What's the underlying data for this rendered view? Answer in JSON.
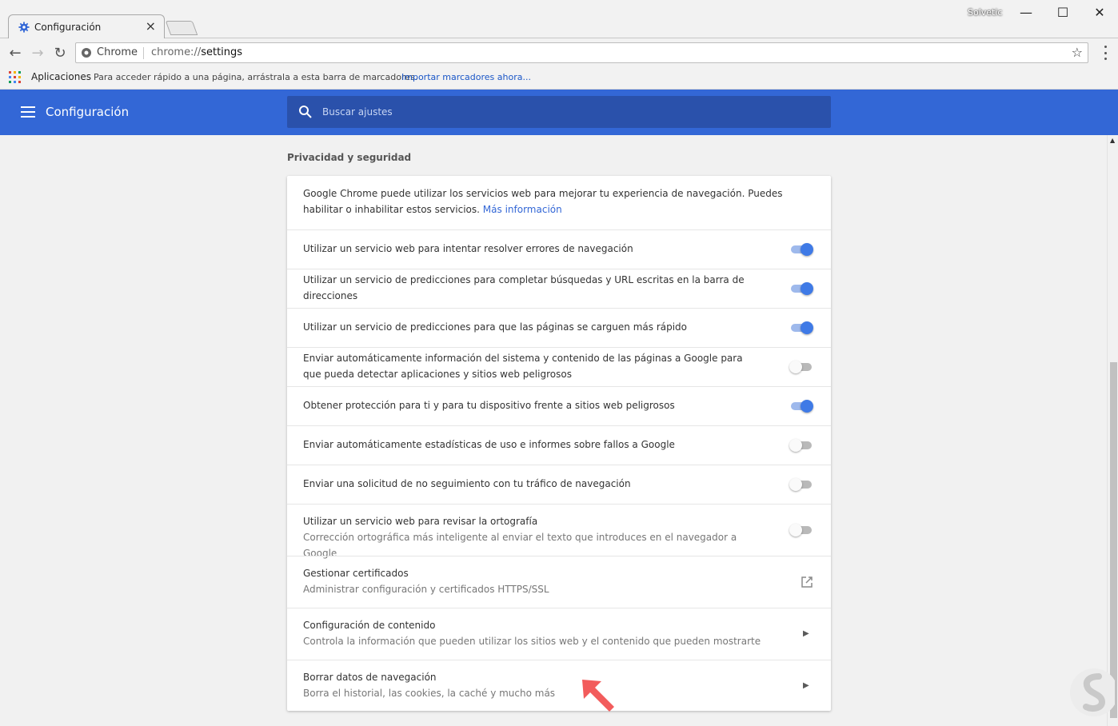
{
  "window": {
    "tab_title": "Configuración",
    "tab_close": "×",
    "user_label": "Solvetic",
    "minimize": "—",
    "maximize": "☐",
    "close": "✕"
  },
  "toolbar": {
    "back": "←",
    "forward": "→",
    "reload": "↻",
    "chip": "Chrome",
    "url_scheme": "chrome://",
    "url_path": "settings",
    "star": "☆"
  },
  "bookmarks": {
    "apps_label": "Aplicaciones",
    "hint": "Para acceder rápido a una página, arrástrala a esta barra de marcadores.",
    "import_link": "Importar marcadores ahora..."
  },
  "header": {
    "title": "Configuración",
    "search_placeholder": "Buscar ajustes"
  },
  "section": {
    "title": "Privacidad y seguridad",
    "intro_text": "Google Chrome puede utilizar los servicios web para mejorar tu experiencia de navegación. Puedes habilitar o inhabilitar estos servicios.",
    "intro_link": "Más información",
    "settings": [
      {
        "label": "Utilizar un servicio web para intentar resolver errores de navegación",
        "enabled": true
      },
      {
        "label": "Utilizar un servicio de predicciones para completar búsquedas y URL escritas en la barra de direcciones",
        "enabled": true
      },
      {
        "label": "Utilizar un servicio de predicciones para que las páginas se carguen más rápido",
        "enabled": true
      },
      {
        "label": "Enviar automáticamente información del sistema y contenido de las páginas a Google para que pueda detectar aplicaciones y sitios web peligrosos",
        "enabled": false
      },
      {
        "label": "Obtener protección para ti y para tu dispositivo frente a sitios web peligrosos",
        "enabled": true
      },
      {
        "label": "Enviar automáticamente estadísticas de uso e informes sobre fallos a Google",
        "enabled": false
      },
      {
        "label": "Enviar una solicitud de no seguimiento con tu tráfico de navegación",
        "enabled": false
      },
      {
        "label": "Utilizar un servicio web para revisar la ortografía",
        "sublabel": "Corrección ortográfica más inteligente al enviar el texto que introduces en el navegador a Google",
        "enabled": false
      }
    ],
    "links": [
      {
        "label": "Gestionar certificados",
        "sublabel": "Administrar configuración y certificados HTTPS/SSL",
        "icon": "external-link-icon"
      },
      {
        "label": "Configuración de contenido",
        "sublabel": "Controla la información que pueden utilizar los sitios web y el contenido que pueden mostrarte",
        "icon": "chevron-right-icon"
      },
      {
        "label": "Borrar datos de navegación",
        "sublabel": "Borra el historial, las cookies, la caché y mucho más",
        "icon": "chevron-right-icon"
      }
    ]
  },
  "colors": {
    "header_blue": "#3367d6",
    "search_blue": "#2a51ab",
    "toggle_on": "#3f7ae6",
    "arrow_red": "#f25c5c"
  }
}
